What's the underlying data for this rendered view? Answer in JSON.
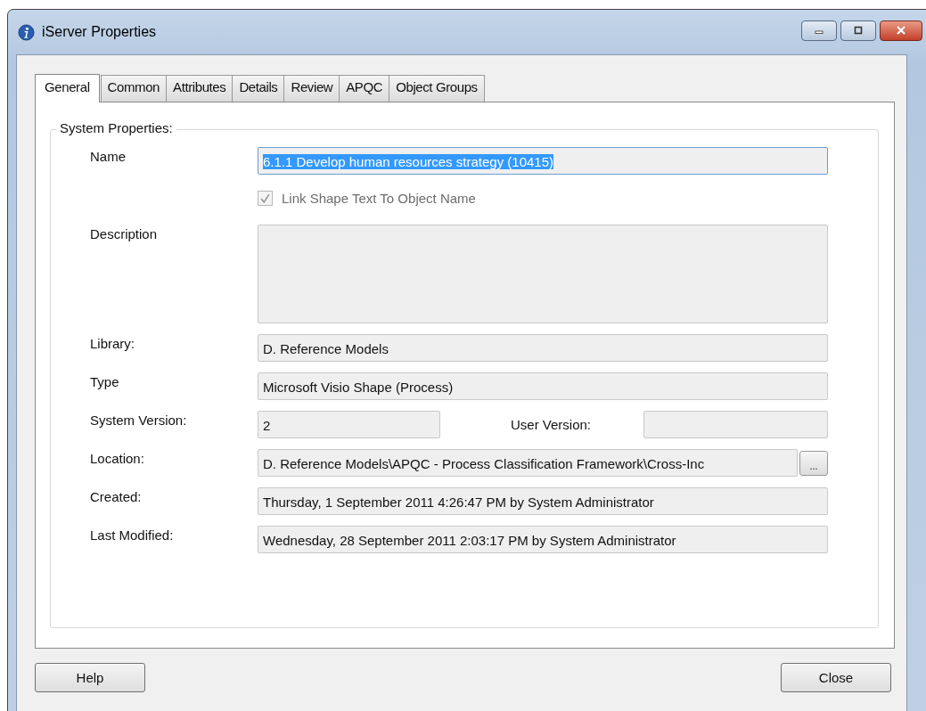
{
  "window": {
    "title": "iServer Properties"
  },
  "tabs": [
    {
      "label": "General",
      "selected": true
    },
    {
      "label": "Common",
      "selected": false
    },
    {
      "label": "Attributes",
      "selected": false
    },
    {
      "label": "Details",
      "selected": false
    },
    {
      "label": "Review",
      "selected": false
    },
    {
      "label": "APQC",
      "selected": false
    },
    {
      "label": "Object Groups",
      "selected": false
    }
  ],
  "group": {
    "title": "System Properties:"
  },
  "fields": [
    {
      "kind": "text",
      "label": "Name",
      "value": "6.1.1 Develop human resources strategy (10415)",
      "focused": true,
      "text_selected": true
    },
    {
      "kind": "checkbox",
      "label": "Link Shape Text To Object Name",
      "checked": true,
      "disabled": true
    },
    {
      "kind": "memo",
      "label": "Description"
    },
    {
      "kind": "text",
      "label": "Library:",
      "value": "D. Reference Models",
      "focused": false,
      "text_selected": false
    },
    {
      "kind": "text",
      "label": "Type",
      "value": "Microsoft Visio Shape (Process)",
      "focused": false,
      "text_selected": false
    },
    {
      "kind": "pair",
      "label": "System Version:",
      "value": "2",
      "label_2": "User Version:"
    },
    {
      "kind": "browse",
      "label": "Location:",
      "value": "D. Reference Models\\APQC - Process Classification Framework\\Cross-Inc",
      "button": "..."
    },
    {
      "kind": "text",
      "label": "Created:",
      "value": "Thursday, 1 September 2011 4:26:47 PM by System Administrator",
      "focused": false,
      "text_selected": false
    },
    {
      "kind": "text",
      "label": "Last Modified:",
      "value": "Wednesday, 28 September 2011 2:03:17 PM by System Administrator",
      "focused": false,
      "text_selected": false
    }
  ],
  "buttons": [
    {
      "label": "Help"
    },
    {
      "label": "Close"
    }
  ]
}
